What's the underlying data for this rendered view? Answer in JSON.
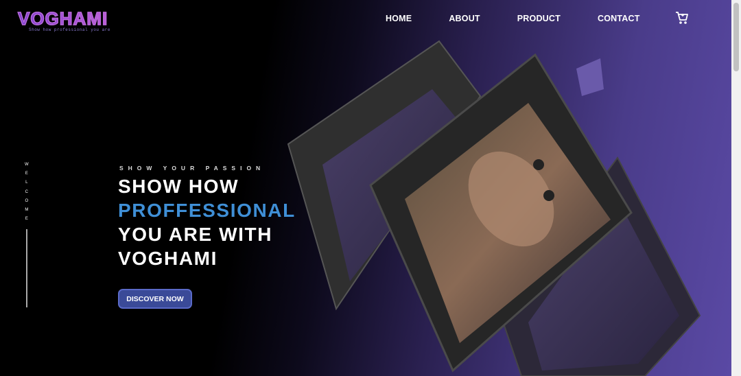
{
  "brand": {
    "logo_text": "VOGHAMI",
    "tagline": "Show how professional you are"
  },
  "nav": {
    "items": [
      "HOME",
      "ABOUT",
      "PRODUCT",
      "CONTACT"
    ],
    "cart_icon": "cart-icon"
  },
  "side": {
    "letters": [
      "W",
      "E",
      "L",
      "C",
      "O",
      "M",
      "E"
    ]
  },
  "hero": {
    "subtitle": "SHOW YOUR PASSION",
    "line1": "SHOW HOW",
    "line2": "PROFFESSIONAL",
    "line3": "YOU ARE WITH",
    "line4": "VOGHAMI",
    "cta": "DISCOVER NOW"
  },
  "colors": {
    "accent": "#3f8fd6",
    "button": "#3a4a98",
    "logo": "#a855d8",
    "bg_gradient_end": "#5b4aa6"
  }
}
